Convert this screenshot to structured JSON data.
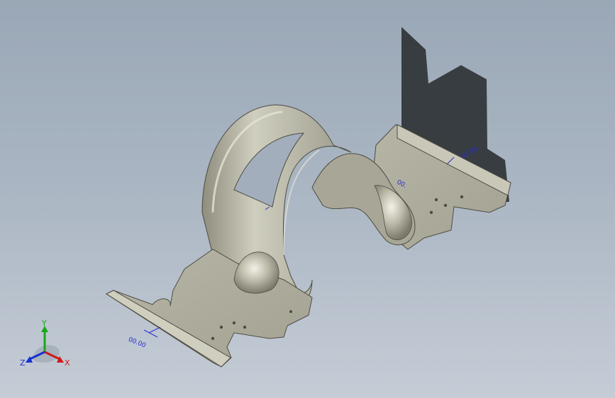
{
  "viewport": {
    "background_top": "#9aa7b6",
    "background_bottom": "#c5ccd6"
  },
  "model": {
    "part_color": "#a9a898",
    "shadow_color": "#2f3336"
  },
  "dimensions": {
    "front": "00.00",
    "back_left": "00.",
    "back_right": "00.00"
  },
  "triad": {
    "x_label": "X",
    "y_label": "Y",
    "z_label": "Z",
    "x_color": "#d01818",
    "y_color": "#18a818",
    "z_color": "#1830d0"
  }
}
